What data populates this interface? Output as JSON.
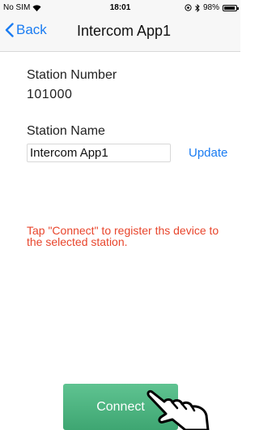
{
  "status_bar": {
    "carrier": "No SIM",
    "wifi_icon": "wifi-icon",
    "time": "18:01",
    "location_icon": "location-icon",
    "bluetooth_icon": "bluetooth-icon",
    "battery": "98%",
    "battery_icon": "battery-icon"
  },
  "nav": {
    "back_label": "Back",
    "title": "Intercom App1"
  },
  "station": {
    "number_label": "Station Number",
    "number_value": "101000",
    "name_label": "Station Name",
    "name_value": "Intercom App1",
    "update_label": "Update"
  },
  "instruction": "Tap \"Connect\" to register ths device to the selected station.",
  "connect": {
    "label": "Connect",
    "color": "#4cb580"
  },
  "colors": {
    "accent": "#1a7cf2",
    "warning": "#e8452c"
  }
}
